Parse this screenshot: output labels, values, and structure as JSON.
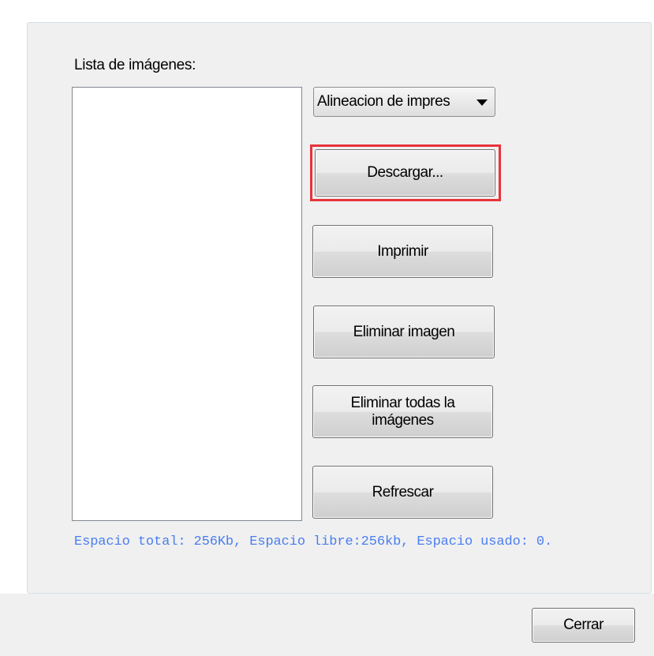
{
  "dialog": {
    "list_label": "Lista de imágenes:",
    "alignment_select": {
      "selected": "Alineacion de impres"
    },
    "buttons": {
      "download": "Descargar...",
      "print": "Imprimir",
      "delete_image": "Eliminar imagen",
      "delete_all": "Eliminar todas la imágenes",
      "refresh": "Refrescar",
      "close": "Cerrar"
    },
    "status_text": "Espacio total: 256Kb, Espacio libre:256kb, Espacio usado: 0.",
    "colors": {
      "highlight": "#e8333b",
      "status_text": "#4a7ef0"
    }
  }
}
